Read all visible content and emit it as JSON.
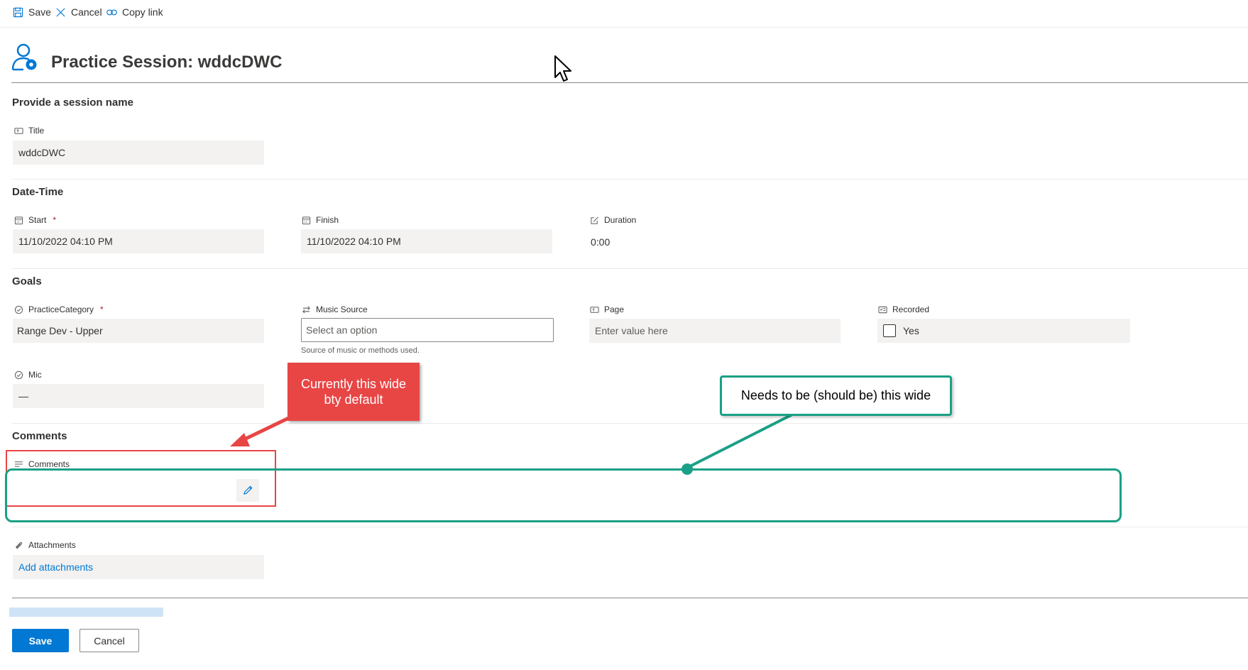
{
  "toolbar": {
    "save_label": "Save",
    "cancel_label": "Cancel",
    "copy_link_label": "Copy link"
  },
  "header": {
    "title": "Practice Session: wddcDWC"
  },
  "sections": {
    "session_name": "Provide a session name",
    "date_time": "Date-Time",
    "goals": "Goals",
    "comments": "Comments"
  },
  "fields": {
    "title": {
      "label": "Title",
      "value": "wddcDWC"
    },
    "start": {
      "label": "Start",
      "required_mark": "*",
      "value": "11/10/2022 04:10 PM"
    },
    "finish": {
      "label": "Finish",
      "value": "11/10/2022 04:10 PM"
    },
    "duration": {
      "label": "Duration",
      "value": "0:00"
    },
    "practice_category": {
      "label": "PracticeCategory",
      "required_mark": "*",
      "value": "Range Dev - Upper"
    },
    "music_source": {
      "label": "Music Source",
      "placeholder": "Select an option",
      "hint": "Source of music or methods used."
    },
    "page": {
      "label": "Page",
      "placeholder": "Enter value here"
    },
    "recorded": {
      "label": "Recorded",
      "option": "Yes",
      "checked": false
    },
    "mic": {
      "label": "Mic",
      "value": "—"
    },
    "comments": {
      "label": "Comments",
      "value": ""
    },
    "attachments": {
      "label": "Attachments",
      "link": "Add attachments"
    }
  },
  "footer": {
    "save_label": "Save",
    "cancel_label": "Cancel"
  },
  "annotations": {
    "current_width": "Currently this wide bty default",
    "desired_width": "Needs to be (should be) this wide"
  },
  "colors": {
    "accent": "#0078d4",
    "callout_red": "#e84545",
    "callout_green": "#1aa086",
    "required": "#a4262c"
  },
  "icons": {
    "save": "floppy-disk",
    "cancel": "x",
    "copy_link": "link",
    "header": "person-gear",
    "text_field": "textbox",
    "calendar": "calendar",
    "duration": "pencil-box",
    "choice": "check-circle",
    "music_source": "arrows-swap",
    "page": "textbox",
    "recorded": "checkbox-grid",
    "comments": "lines",
    "edit": "pencil",
    "attachments": "paperclip"
  }
}
